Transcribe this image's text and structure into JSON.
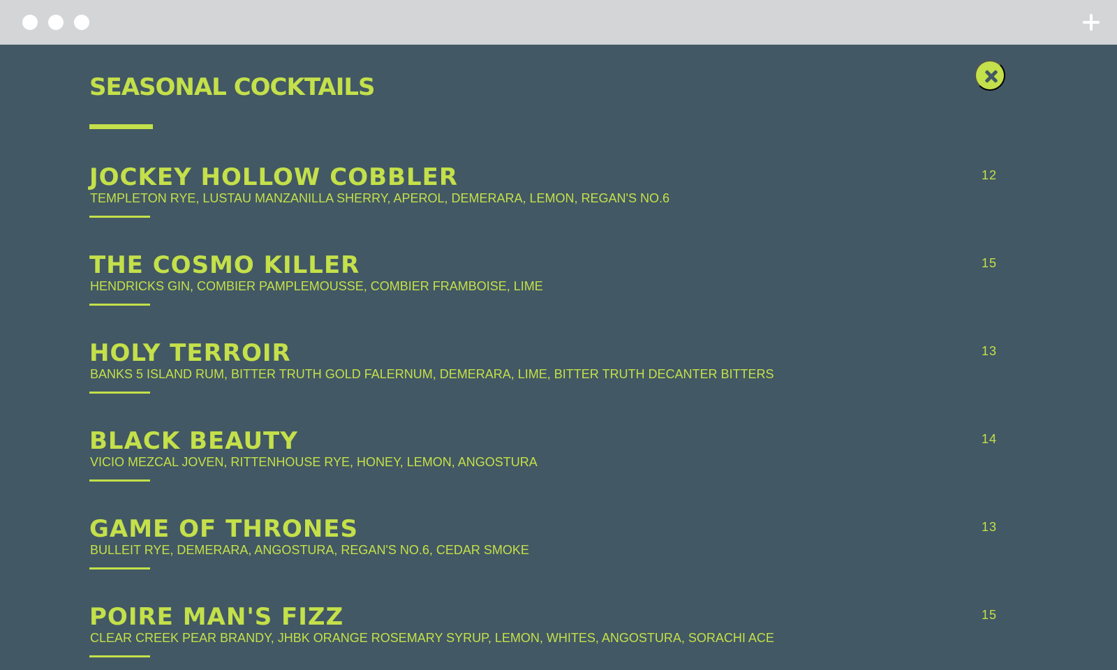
{
  "theme": {
    "background": "#425864",
    "accent": "#c4e04a",
    "browser_chrome": "#d4d5d7"
  },
  "browser": {
    "window_controls": [
      "window-dot",
      "window-dot",
      "window-dot"
    ],
    "new_tab_icon": "plus-icon"
  },
  "menu": {
    "title": "SEASONAL COCKTAILS",
    "close_icon": "close-icon",
    "items": [
      {
        "name": "JOCKEY HOLLOW COBBLER",
        "ingredients": "TEMPLETON RYE, LUSTAU MANZANILLA SHERRY, APEROL, DEMERARA, LEMON, REGAN'S NO.6",
        "price": "12"
      },
      {
        "name": "THE COSMO KILLER",
        "ingredients": "HENDRICKS GIN, COMBIER PAMPLEMOUSSE, COMBIER FRAMBOISE, LIME",
        "price": "15"
      },
      {
        "name": "HOLY TERROIR",
        "ingredients": "BANKS 5 ISLAND RUM, BITTER TRUTH GOLD FALERNUM, DEMERARA, LIME, BITTER TRUTH DECANTER BITTERS",
        "price": "13"
      },
      {
        "name": "BLACK BEAUTY",
        "ingredients": "VICIO MEZCAL JOVEN, RITTENHOUSE RYE, HONEY, LEMON, ANGOSTURA",
        "price": "14"
      },
      {
        "name": "GAME OF THRONES",
        "ingredients": "BULLEIT RYE, DEMERARA, ANGOSTURA, REGAN'S NO.6, CEDAR SMOKE",
        "price": "13"
      },
      {
        "name": "POIRE MAN'S FIZZ",
        "ingredients": "CLEAR CREEK PEAR BRANDY, JHBK ORANGE ROSEMARY SYRUP, LEMON, WHITES, ANGOSTURA, SORACHI ACE",
        "price": "15"
      }
    ]
  }
}
